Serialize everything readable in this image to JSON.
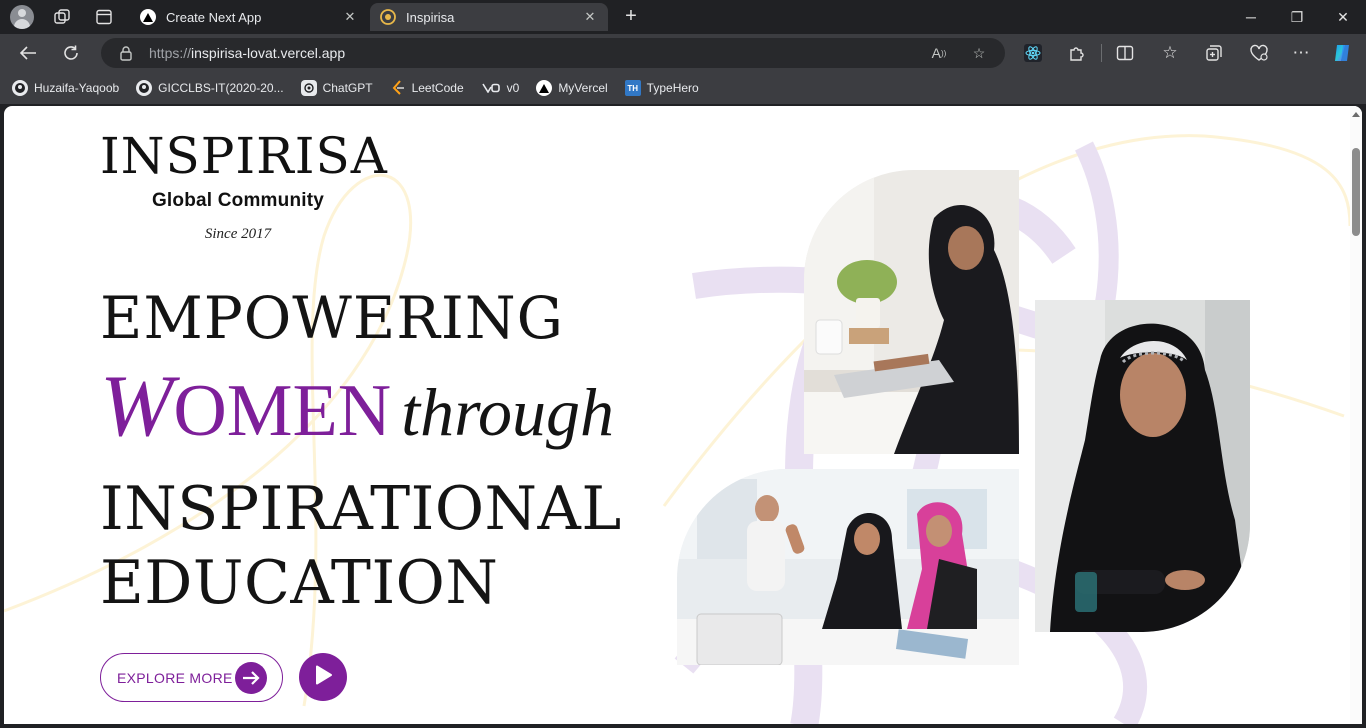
{
  "browser": {
    "tabs": [
      {
        "title": "Create Next App",
        "active": false
      },
      {
        "title": "Inspirisa",
        "active": true
      }
    ],
    "address": {
      "protocol": "https://",
      "host": "inspirisa-lovat.vercel.app"
    },
    "bookmarks": [
      {
        "label": "Huzaifa-Yaqoob",
        "icon": "github-icon"
      },
      {
        "label": "GICCLBS-IT(2020-20...",
        "icon": "github-icon"
      },
      {
        "label": "ChatGPT",
        "icon": "chatgpt-icon"
      },
      {
        "label": "LeetCode",
        "icon": "leetcode-icon"
      },
      {
        "label": "v0",
        "icon": "v0-icon"
      },
      {
        "label": "MyVercel",
        "icon": "vercel-icon"
      },
      {
        "label": "TypeHero",
        "icon": "typehero-icon",
        "icon_text": "TH"
      }
    ]
  },
  "page": {
    "brand": {
      "name": "INSPIRISA",
      "subtitle": "Global Community",
      "since": "Since 2017"
    },
    "headline": {
      "line1": "EMPOWERING",
      "women_cap": "W",
      "women_rest": "OMEN",
      "through": "through",
      "line3": "INSPIRATIONAL",
      "line4": "EDUCATION"
    },
    "cta": {
      "explore_label": "EXPLORE MORE"
    },
    "colors": {
      "accent": "#7e1f9a",
      "decor_lavender": "#e9e0f2",
      "decor_cream": "#fdf3d6"
    }
  }
}
